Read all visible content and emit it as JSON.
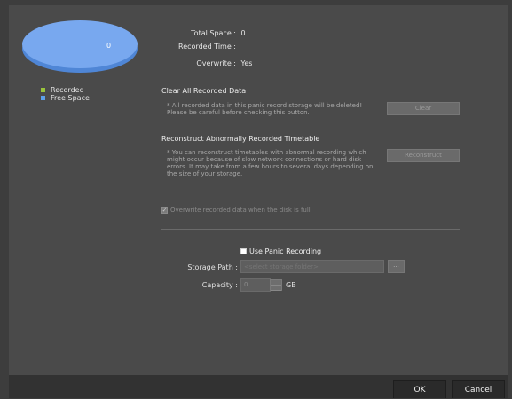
{
  "chart": {
    "center_label": "0",
    "colors": {
      "free": "#78a8ef",
      "free_edge": "#4f86d6",
      "recorded": "#9ac43c"
    }
  },
  "legend": [
    {
      "label": "Recorded",
      "color": "#9ac43c"
    },
    {
      "label": "Free Space",
      "color": "#5da0ea"
    }
  ],
  "info": {
    "total_space_label": "Total Space :",
    "total_space_value": "0",
    "recorded_time_label": "Recorded Time :",
    "recorded_time_value": "",
    "overwrite_label": "Overwrite :",
    "overwrite_value": "Yes"
  },
  "clear_section": {
    "title": "Clear All Recorded Data",
    "desc_line1": "* All recorded data in this panic record storage will be deleted!",
    "desc_line2": "Please be careful before checking this button.",
    "button": "Clear"
  },
  "reconstruct_section": {
    "title": "Reconstruct Abnormally Recorded Timetable",
    "desc_line1": "* You can reconstruct timetables with abnormal recording which",
    "desc_line2": "might occur because of slow network connections or hard disk",
    "desc_line3": "errors. It may take from a few hours to several days depending on",
    "desc_line4": "the size of your storage.",
    "button": "Reconstruct"
  },
  "overwrite_checkbox": {
    "label": "Overwrite recorded data when the disk is full",
    "checked": true
  },
  "panic": {
    "use_label": "Use Panic Recording",
    "storage_path_label": "Storage Path :",
    "storage_path_placeholder": "<select storage folder>",
    "browse_label": "...",
    "capacity_label": "Capacity :",
    "capacity_value": "0",
    "capacity_unit": "GB"
  },
  "footer": {
    "ok": "OK",
    "cancel": "Cancel"
  }
}
